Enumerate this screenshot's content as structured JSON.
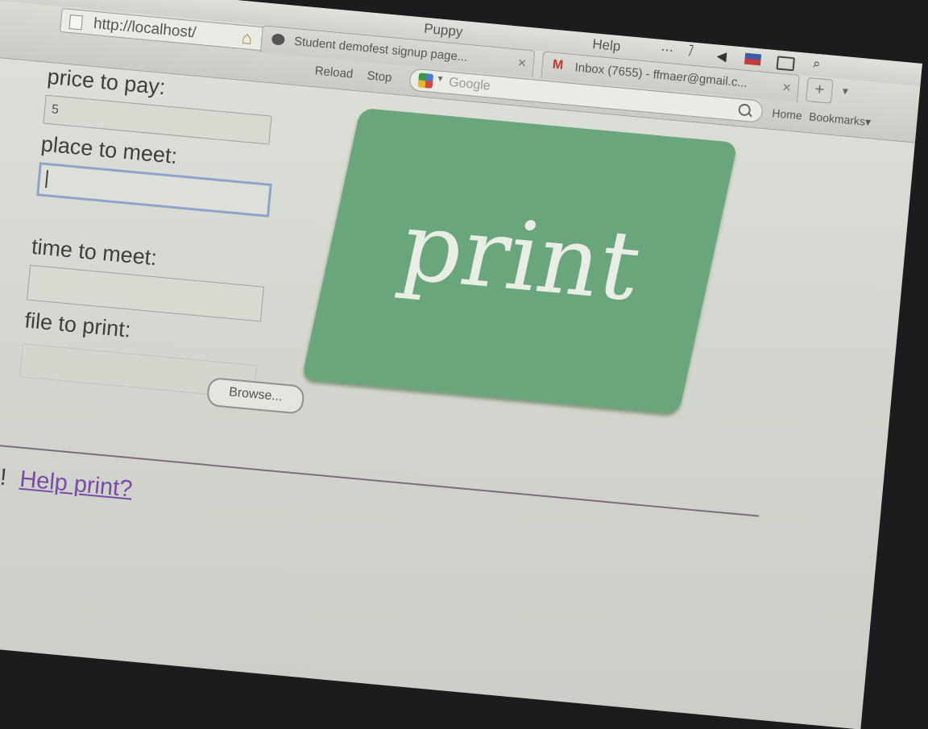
{
  "menubar": {
    "app_name": "Puppy",
    "help": "Help",
    "dots": "···"
  },
  "toolbar": {
    "url": "http://localhost/",
    "reload": "Reload",
    "stop": "Stop",
    "search_placeholder": "Google",
    "home": "Home",
    "bookmarks": "Bookmarks"
  },
  "tabs": [
    {
      "label": "Student demofest signup page..."
    },
    {
      "label": "Inbox (7655) - ffmaer@gmail.c..."
    }
  ],
  "form": {
    "price_label": "price to pay:",
    "price_value": "5",
    "place_label": "place to meet:",
    "place_value": "",
    "time_label": "time to meet:",
    "time_value": "",
    "file_label": "file to print:",
    "browse_label": "Browse...",
    "print_label": "print"
  },
  "footer": {
    "greeting": "Hi!",
    "help_link": "Help print?"
  },
  "colors": {
    "print_button": "#6aa67c",
    "link": "#7a4aa8",
    "divider": "#7d6b80"
  }
}
